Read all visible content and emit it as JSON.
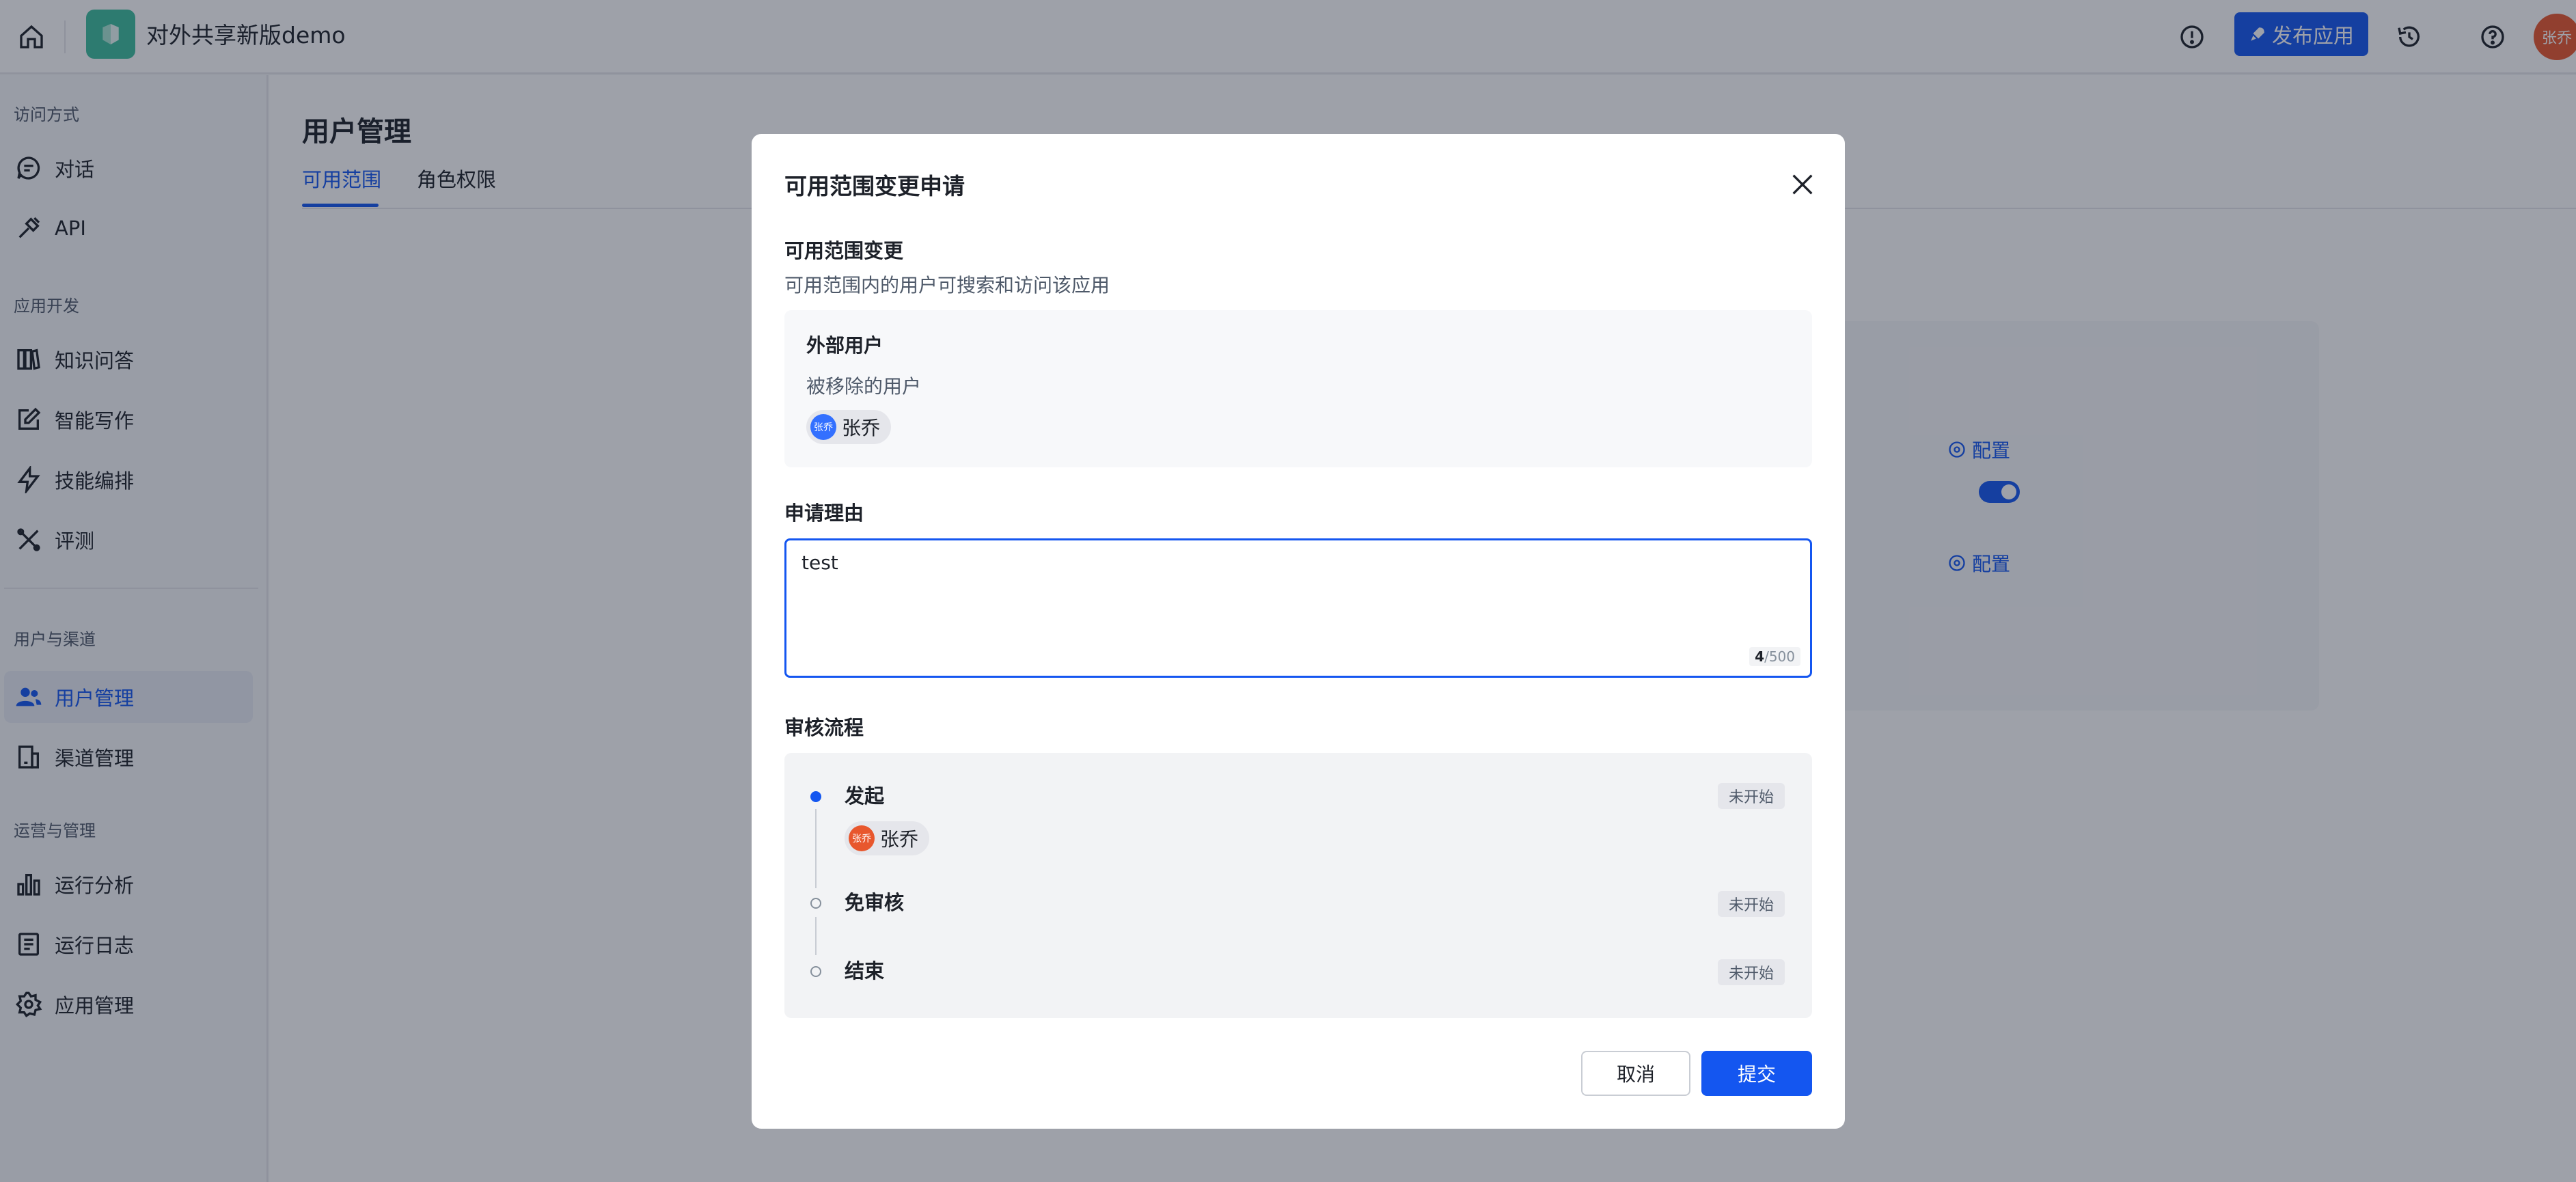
{
  "header": {
    "app_name": "对外共享新版demo",
    "publish_label": "发布应用",
    "user_avatar_text": "张乔"
  },
  "sidebar": {
    "sections": [
      {
        "title": "访问方式"
      },
      {
        "title": "应用开发"
      },
      {
        "title": "用户与渠道"
      },
      {
        "title": "运营与管理"
      }
    ],
    "items": [
      {
        "label": "对话",
        "icon": "chat-icon"
      },
      {
        "label": "API",
        "icon": "api-plug-icon"
      },
      {
        "label": "知识问答",
        "icon": "book-icon"
      },
      {
        "label": "智能写作",
        "icon": "write-icon"
      },
      {
        "label": "技能编排",
        "icon": "lightning-icon"
      },
      {
        "label": "评测",
        "icon": "tools-icon"
      },
      {
        "label": "用户管理",
        "icon": "users-icon",
        "active": true
      },
      {
        "label": "渠道管理",
        "icon": "channel-icon"
      },
      {
        "label": "运行分析",
        "icon": "bar-chart-icon"
      },
      {
        "label": "运行日志",
        "icon": "log-icon"
      },
      {
        "label": "应用管理",
        "icon": "gear-icon"
      }
    ]
  },
  "main": {
    "title": "用户管理",
    "tabs": [
      {
        "label": "可用范围",
        "active": true
      },
      {
        "label": "角色权限",
        "active": false
      }
    ],
    "config_label": "配置"
  },
  "modal": {
    "title": "可用范围变更申请",
    "scope_section_label": "可用范围变更",
    "scope_section_desc": "可用范围内的用户可搜索和访问该应用",
    "scope_group_title": "外部用户",
    "scope_group_sub": "被移除的用户",
    "removed_user": {
      "name": "张乔",
      "avatar_text": "张乔"
    },
    "reason_label": "申请理由",
    "reason_value": "test",
    "reason_count": "4",
    "reason_max": "/500",
    "flow_label": "审核流程",
    "flow_steps": [
      {
        "name": "发起",
        "status": "未开始",
        "user": "张乔",
        "avatar_text": "张乔"
      },
      {
        "name": "免审核",
        "status": "未开始"
      },
      {
        "name": "结束",
        "status": "未开始"
      }
    ],
    "cancel_label": "取消",
    "submit_label": "提交"
  },
  "colors": {
    "primary": "#1456f0",
    "logo": "#3dbd9d",
    "avatar_orange": "#e8572d",
    "avatar_blue": "#3370ff"
  }
}
